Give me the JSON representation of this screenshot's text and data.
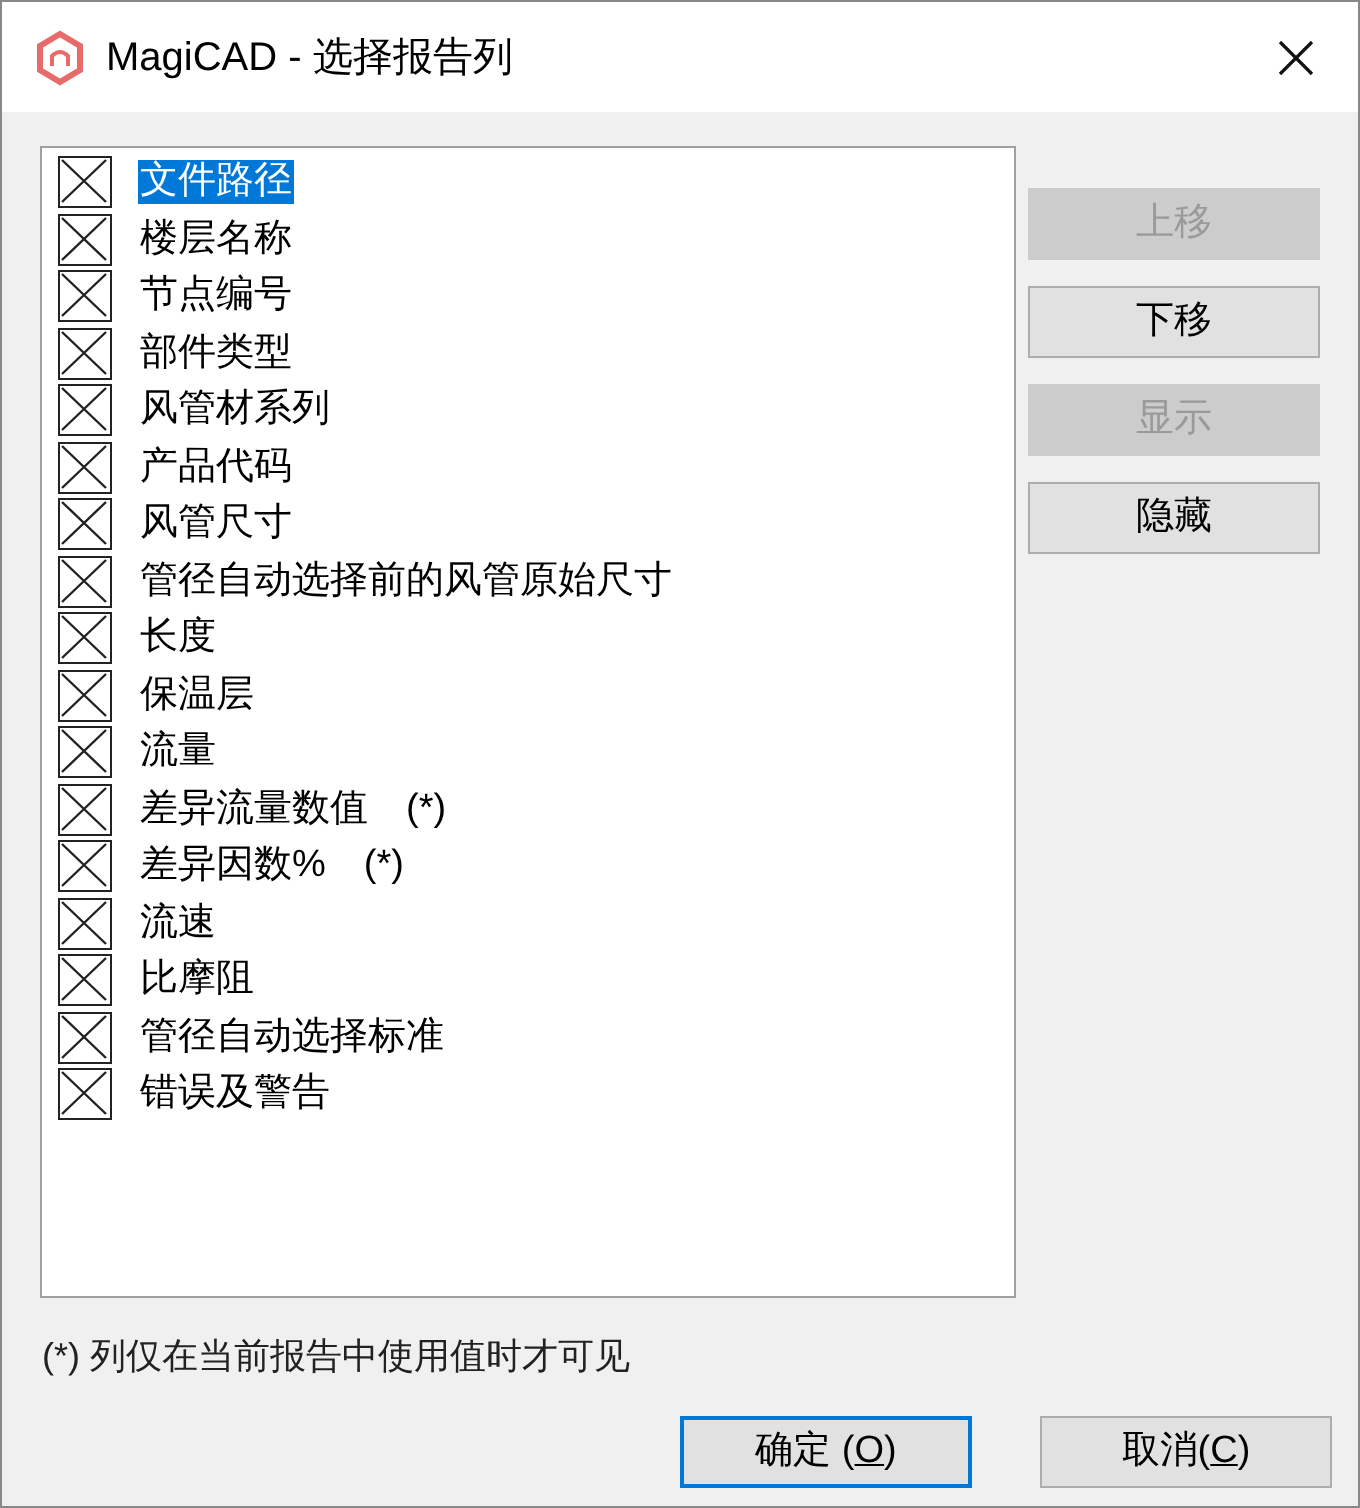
{
  "window": {
    "title": "MagiCAD - 选择报告列"
  },
  "columns": [
    {
      "label": "文件路径",
      "checked": true,
      "selected": true
    },
    {
      "label": "楼层名称",
      "checked": true,
      "selected": false
    },
    {
      "label": "节点编号",
      "checked": true,
      "selected": false
    },
    {
      "label": "部件类型",
      "checked": true,
      "selected": false
    },
    {
      "label": "风管材系列",
      "checked": true,
      "selected": false
    },
    {
      "label": "产品代码",
      "checked": true,
      "selected": false
    },
    {
      "label": "风管尺寸",
      "checked": true,
      "selected": false
    },
    {
      "label": "管径自动选择前的风管原始尺寸",
      "checked": true,
      "selected": false
    },
    {
      "label": "长度",
      "checked": true,
      "selected": false
    },
    {
      "label": "保温层",
      "checked": true,
      "selected": false
    },
    {
      "label": "流量",
      "checked": true,
      "selected": false
    },
    {
      "label": "差异流量数值　(*)",
      "checked": true,
      "selected": false
    },
    {
      "label": "差异因数%　(*)",
      "checked": true,
      "selected": false
    },
    {
      "label": "流速",
      "checked": true,
      "selected": false
    },
    {
      "label": "比摩阻",
      "checked": true,
      "selected": false
    },
    {
      "label": "管径自动选择标准",
      "checked": true,
      "selected": false
    },
    {
      "label": "错误及警告",
      "checked": true,
      "selected": false
    }
  ],
  "side_buttons": [
    {
      "label": "上移",
      "disabled": true
    },
    {
      "label": "下移",
      "disabled": false
    },
    {
      "label": "显示",
      "disabled": true
    },
    {
      "label": "隐藏",
      "disabled": false
    }
  ],
  "note": "(*) 列仅在当前报告中使用值时才可见",
  "dialog_buttons": [
    {
      "before": "确定 (",
      "accel": "O",
      "after": ")",
      "default": true
    },
    {
      "before": "取消(",
      "accel": "C",
      "after": ")",
      "default": false
    }
  ]
}
